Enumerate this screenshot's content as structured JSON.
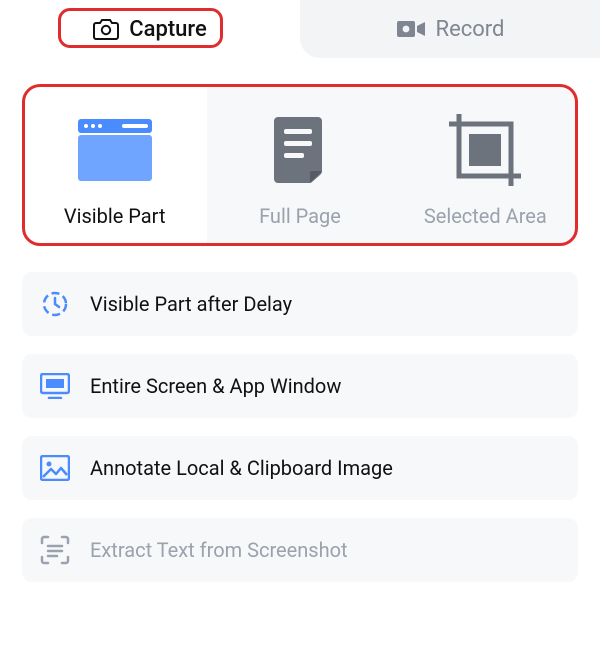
{
  "tabs": {
    "capture": "Capture",
    "record": "Record"
  },
  "modes": {
    "visible_part": "Visible Part",
    "full_page": "Full Page",
    "selected_area": "Selected Area"
  },
  "options": {
    "delay": "Visible Part after Delay",
    "entire_screen": "Entire Screen & App Window",
    "annotate": "Annotate Local & Clipboard Image",
    "extract_text": "Extract Text from Screenshot"
  },
  "colors": {
    "accent": "#4a8cff",
    "callout": "#e02c2c",
    "muted": "#9aa2ad"
  }
}
